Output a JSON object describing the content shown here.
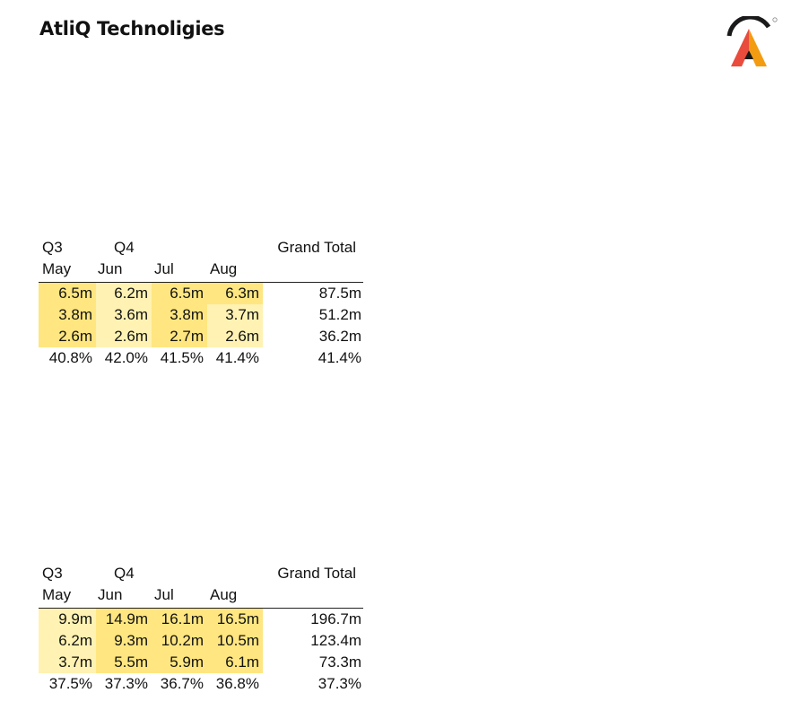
{
  "header": {
    "company_name": "AtliQ Technoligies"
  },
  "logo": {
    "icon": "atliq-logo-icon",
    "colors": [
      "#e94b3c",
      "#f39c12",
      "#1a1a1a"
    ]
  },
  "highlight_colors": {
    "strong": "#ffe680",
    "light": "#fff2b3"
  },
  "tables": [
    {
      "quarters": [
        "Q3",
        "Q4"
      ],
      "grand_total_label": "Grand Total",
      "months": [
        "May",
        "Jun",
        "Jul",
        "Aug"
      ],
      "rows": [
        {
          "values": [
            "6.5m",
            "6.2m",
            "6.5m",
            "6.3m"
          ],
          "shade": [
            "strong",
            "light",
            "strong",
            "strong"
          ],
          "total": "87.5m"
        },
        {
          "values": [
            "3.8m",
            "3.6m",
            "3.8m",
            "3.7m"
          ],
          "shade": [
            "strong",
            "light",
            "strong",
            "light"
          ],
          "total": "51.2m"
        },
        {
          "values": [
            "2.6m",
            "2.6m",
            "2.7m",
            "2.6m"
          ],
          "shade": [
            "strong",
            "light",
            "strong",
            "light"
          ],
          "total": "36.2m"
        }
      ],
      "pct_row": {
        "values": [
          "40.8%",
          "42.0%",
          "41.5%",
          "41.4%"
        ],
        "total": "41.4%"
      }
    },
    {
      "quarters": [
        "Q3",
        "Q4"
      ],
      "grand_total_label": "Grand Total",
      "months": [
        "May",
        "Jun",
        "Jul",
        "Aug"
      ],
      "rows": [
        {
          "values": [
            "9.9m",
            "14.9m",
            "16.1m",
            "16.5m"
          ],
          "shade": [
            "light",
            "strong",
            "strong",
            "strong"
          ],
          "total": "196.7m"
        },
        {
          "values": [
            "6.2m",
            "9.3m",
            "10.2m",
            "10.5m"
          ],
          "shade": [
            "light",
            "strong",
            "strong",
            "strong"
          ],
          "total": "123.4m"
        },
        {
          "values": [
            "3.7m",
            "5.5m",
            "5.9m",
            "6.1m"
          ],
          "shade": [
            "light",
            "strong",
            "strong",
            "strong"
          ],
          "total": "73.3m"
        }
      ],
      "pct_row": {
        "values": [
          "37.5%",
          "37.3%",
          "36.7%",
          "36.8%"
        ],
        "total": "37.3%"
      }
    }
  ]
}
